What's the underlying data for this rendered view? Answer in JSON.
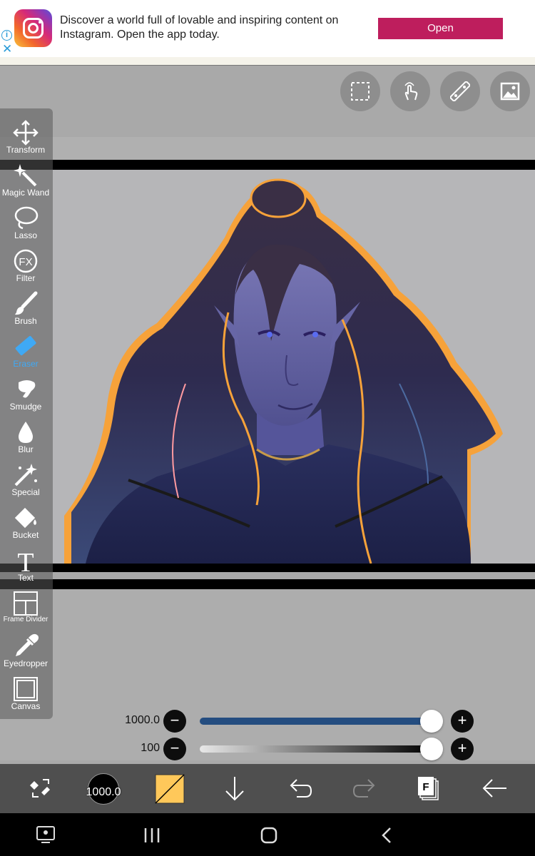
{
  "ad": {
    "text": "Discover a world full of lovable and inspiring content on Instagram. Open the app today.",
    "button": "Open",
    "info_icon": "info-icon",
    "close_icon": "close-icon",
    "colors": {
      "button": "#be1e5d",
      "icon": "#2a9bd8"
    }
  },
  "top_tools": [
    "selection-icon",
    "hand-gesture-icon",
    "ruler-icon",
    "image-icon"
  ],
  "toolbar": {
    "tools": [
      {
        "label": "Transform",
        "icon": "move-icon"
      },
      {
        "label": "Magic Wand",
        "icon": "magic-wand-icon"
      },
      {
        "label": "Lasso",
        "icon": "lasso-icon"
      },
      {
        "label": "Filter",
        "icon": "fx-icon",
        "icon_text": "FX"
      },
      {
        "label": "Brush",
        "icon": "brush-icon"
      },
      {
        "label": "Eraser",
        "icon": "eraser-icon",
        "active": true
      },
      {
        "label": "Smudge",
        "icon": "smudge-icon"
      },
      {
        "label": "Blur",
        "icon": "blur-drop-icon"
      },
      {
        "label": "Special",
        "icon": "special-icon"
      },
      {
        "label": "Bucket",
        "icon": "bucket-icon"
      },
      {
        "label": "Text",
        "icon": "text-icon",
        "icon_text": "T"
      },
      {
        "label": "Frame Divider",
        "icon": "frame-divider-icon"
      },
      {
        "label": "Eyedropper",
        "icon": "eyedropper-icon"
      },
      {
        "label": "Canvas",
        "icon": "canvas-icon"
      }
    ],
    "active_color": "#3fa9f5"
  },
  "sliders": {
    "size": {
      "value": "1000.0",
      "fill_fraction": 1.0,
      "color": "#244d80"
    },
    "opacity": {
      "value": "100",
      "fill_fraction": 1.0
    },
    "minus": "−",
    "plus": "+"
  },
  "bottom_bar": {
    "brush_size": "1000.0",
    "primary_color": "#ffc85a",
    "layer_badge": "F",
    "icons": [
      "swap-tools-icon",
      "brush-size-icon",
      "color-swatch-icon",
      "download-arrow-icon",
      "undo-icon",
      "redo-icon",
      "layers-icon",
      "back-arrow-icon"
    ]
  },
  "nav": {
    "icons": [
      "screen-share-icon",
      "recent-apps-icon",
      "home-icon",
      "back-icon"
    ]
  }
}
